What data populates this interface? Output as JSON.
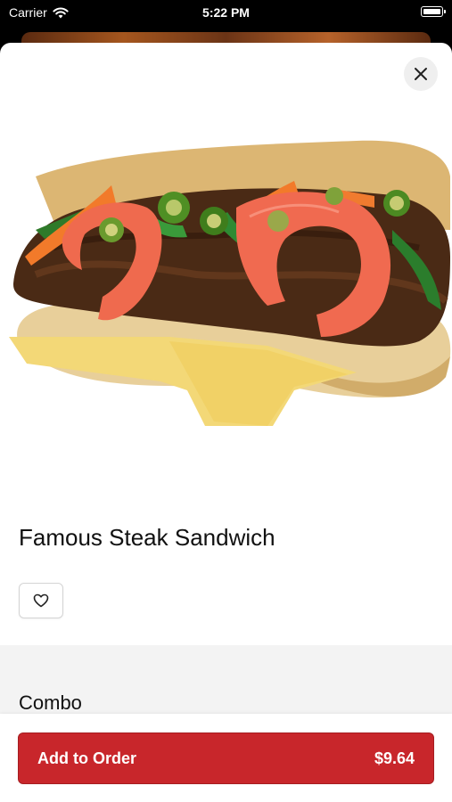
{
  "status_bar": {
    "carrier": "Carrier",
    "time": "5:22 PM",
    "battery_level": 1.0
  },
  "icons": {
    "wifi": "wifi-icon",
    "battery": "battery-icon",
    "close": "close-icon",
    "heart": "heart-icon"
  },
  "item": {
    "title": "Famous Steak Sandwich",
    "image": "steak-sandwich-photo"
  },
  "options": {
    "section_title": "Combo"
  },
  "footer": {
    "add_label": "Add to Order",
    "price": "$9.64"
  },
  "colors": {
    "accent": "#c8262b",
    "options_bg": "#f3f3f3"
  }
}
